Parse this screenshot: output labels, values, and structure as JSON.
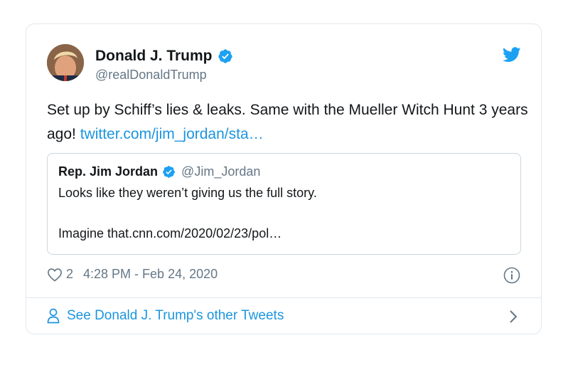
{
  "tweet": {
    "author_name": "Donald J. Trump",
    "author_handle": "@realDonaldTrump",
    "text": "Set up by Schiff’s lies & leaks. Same with the Mueller Witch Hunt 3 years ago! ",
    "link_text": "twitter.com/jim_jordan/sta…",
    "likes": "2",
    "timestamp": "4:28 PM - Feb 24, 2020"
  },
  "quote": {
    "author_name": "Rep. Jim Jordan",
    "author_handle": "@Jim_Jordan",
    "line1": "Looks like they weren’t giving us the full story.",
    "line2": "Imagine that.cnn.com/2020/02/23/pol…"
  },
  "footer": {
    "label": "See Donald J. Trump's other Tweets"
  },
  "colors": {
    "link": "#1b95e0",
    "verified": "#1da1f2",
    "secondary_text": "#657786",
    "border": "#e1e8ed"
  },
  "icons": [
    "verified-badge-icon",
    "twitter-bird-icon",
    "heart-icon",
    "info-icon",
    "person-icon",
    "chevron-right-icon"
  ]
}
